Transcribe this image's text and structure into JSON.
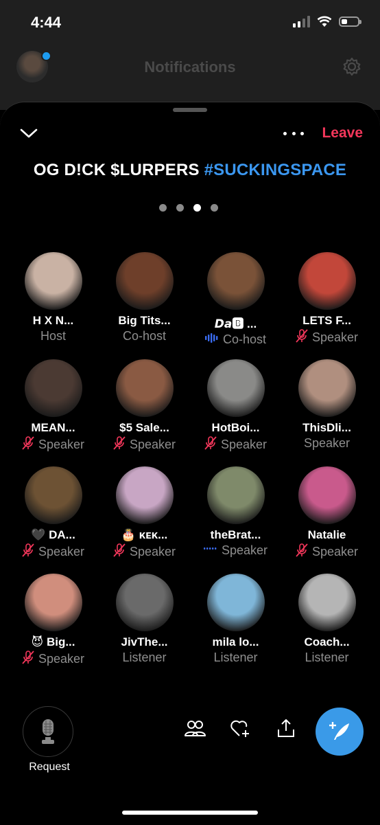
{
  "status": {
    "time": "4:44"
  },
  "header": {
    "title": "Notifications"
  },
  "space": {
    "title_main": "OG D!CK $LURPERS ",
    "title_hashtag": "#SUCKINGSPACE",
    "leave_label": "Leave"
  },
  "members": [
    {
      "name": "H X N...",
      "role": "Host",
      "indicator": "none",
      "color": "#c9b2a4"
    },
    {
      "name": "Big Tits...",
      "role": "Co-host",
      "indicator": "none",
      "color": "#6e3f2a"
    },
    {
      "name": "𝘿𝙖🅱 ...",
      "role": "Co-host",
      "indicator": "speaking",
      "color": "#7a5238"
    },
    {
      "name": "LETS F...",
      "role": "Speaker",
      "indicator": "muted",
      "color": "#c2473a"
    },
    {
      "name": "MEAN...",
      "role": "Speaker",
      "indicator": "muted",
      "color": "#4b3a33"
    },
    {
      "name": "$5 Sale...",
      "role": "Speaker",
      "indicator": "muted",
      "color": "#8a5a43"
    },
    {
      "name": "HotBoi...",
      "role": "Speaker",
      "indicator": "muted",
      "color": "#8a8a88"
    },
    {
      "name": "ThisDli...",
      "role": "Speaker",
      "indicator": "none",
      "color": "#b08f7f"
    },
    {
      "name": "🖤 DA...",
      "role": "Speaker",
      "indicator": "muted",
      "color": "#6d5234"
    },
    {
      "name": "🎂 ᴋᴇᴋ...",
      "role": "Speaker",
      "indicator": "muted",
      "color": "#c8a6c4"
    },
    {
      "name": "theBrat...",
      "role": "Speaker",
      "indicator": "listening",
      "color": "#7f8a6a"
    },
    {
      "name": "Natalie",
      "role": "Speaker",
      "indicator": "muted",
      "color": "#c95a8c"
    },
    {
      "name": "😈 Big...",
      "role": "Speaker",
      "indicator": "muted",
      "color": "#d08e7d"
    },
    {
      "name": "JivThe...",
      "role": "Listener",
      "indicator": "none",
      "color": "#6a6a6a"
    },
    {
      "name": "mila lo...",
      "role": "Listener",
      "indicator": "none",
      "color": "#7fb6d8"
    },
    {
      "name": "Coach...",
      "role": "Listener",
      "indicator": "none",
      "color": "#b5b5b5"
    }
  ],
  "bottom": {
    "request_label": "Request"
  },
  "colors": {
    "accent": "#1d9bf0",
    "leave": "#f4375b",
    "muted": "#f4375b",
    "speaking": "#3a6cf0",
    "fab": "#3a9ae8"
  }
}
